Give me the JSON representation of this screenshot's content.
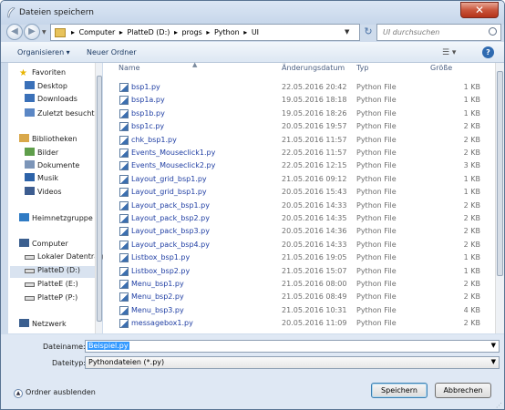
{
  "window": {
    "title": "Dateien speichern",
    "close_glyph": "✕"
  },
  "address": {
    "crumbs": [
      "Computer",
      "PlatteD (D:)",
      "progs",
      "Python",
      "UI"
    ],
    "separator": "▸",
    "search_placeholder": "UI durchsuchen"
  },
  "toolbar": {
    "organize": "Organisieren ▾",
    "new_folder": "Neuer Ordner",
    "view_glyph": "☰ ▾",
    "help": "?"
  },
  "sidebar": {
    "items": [
      {
        "label": "Favoriten",
        "icon": "star-icon",
        "color": "#e8b400",
        "indent": 0
      },
      {
        "label": "Desktop",
        "icon": "desktop-icon",
        "color": "#3a70b8",
        "indent": 1
      },
      {
        "label": "Downloads",
        "icon": "downloads-icon",
        "color": "#3a70b8",
        "indent": 1
      },
      {
        "label": "Zuletzt besucht",
        "icon": "recent-icon",
        "color": "#5b87c5",
        "indent": 1
      },
      {
        "label": "Bibliotheken",
        "icon": "libraries-icon",
        "color": "#d9a84a",
        "indent": 0
      },
      {
        "label": "Bilder",
        "icon": "pictures-icon",
        "color": "#5f9e4b",
        "indent": 1
      },
      {
        "label": "Dokumente",
        "icon": "documents-icon",
        "color": "#7c95b8",
        "indent": 1
      },
      {
        "label": "Musik",
        "icon": "music-icon",
        "color": "#2c62a8",
        "indent": 1
      },
      {
        "label": "Videos",
        "icon": "videos-icon",
        "color": "#3d5d90",
        "indent": 1
      },
      {
        "label": "Heimnetzgruppe",
        "icon": "homegroup-icon",
        "color": "#2f7bc4",
        "indent": 0
      },
      {
        "label": "Computer",
        "icon": "computer-icon",
        "color": "#3b5f8f",
        "indent": 0
      },
      {
        "label": "Lokaler Datenträg",
        "icon": "drive-icon",
        "color": "#8a8a8a",
        "indent": 1
      },
      {
        "label": "PlatteD (D:)",
        "icon": "drive-icon",
        "color": "#8a8a8a",
        "indent": 1
      },
      {
        "label": "PlatteE (E:)",
        "icon": "drive-icon",
        "color": "#8a8a8a",
        "indent": 1
      },
      {
        "label": "PlatteP (P:)",
        "icon": "drive-icon",
        "color": "#8a8a8a",
        "indent": 1
      },
      {
        "label": "Netzwerk",
        "icon": "network-icon",
        "color": "#3b5f8f",
        "indent": 0
      }
    ]
  },
  "columns": {
    "name": "Name",
    "date": "Änderungsdatum",
    "type": "Typ",
    "size": "Größe"
  },
  "files": [
    {
      "name": "bsp1.py",
      "date": "22.05.2016 20:42",
      "type": "Python File",
      "size": "1 KB"
    },
    {
      "name": "bsp1a.py",
      "date": "19.05.2016 18:18",
      "type": "Python File",
      "size": "1 KB"
    },
    {
      "name": "bsp1b.py",
      "date": "19.05.2016 18:26",
      "type": "Python File",
      "size": "1 KB"
    },
    {
      "name": "bsp1c.py",
      "date": "20.05.2016 19:57",
      "type": "Python File",
      "size": "2 KB"
    },
    {
      "name": "chk_bsp1.py",
      "date": "21.05.2016 11:57",
      "type": "Python File",
      "size": "2 KB"
    },
    {
      "name": "Events_Mouseclick1.py",
      "date": "22.05.2016 11:57",
      "type": "Python File",
      "size": "2 KB"
    },
    {
      "name": "Events_Mouseclick2.py",
      "date": "22.05.2016 12:15",
      "type": "Python File",
      "size": "3 KB"
    },
    {
      "name": "Layout_grid_bsp1.py",
      "date": "21.05.2016 09:12",
      "type": "Python File",
      "size": "1 KB"
    },
    {
      "name": "Layout_grid_bsp1.py",
      "date": "20.05.2016 15:43",
      "type": "Python File",
      "size": "1 KB"
    },
    {
      "name": "Layout_pack_bsp1.py",
      "date": "20.05.2016 14:33",
      "type": "Python File",
      "size": "2 KB"
    },
    {
      "name": "Layout_pack_bsp2.py",
      "date": "20.05.2016 14:35",
      "type": "Python File",
      "size": "2 KB"
    },
    {
      "name": "Layout_pack_bsp3.py",
      "date": "20.05.2016 14:36",
      "type": "Python File",
      "size": "2 KB"
    },
    {
      "name": "Layout_pack_bsp4.py",
      "date": "20.05.2016 14:33",
      "type": "Python File",
      "size": "2 KB"
    },
    {
      "name": "Listbox_bsp1.py",
      "date": "21.05.2016 19:05",
      "type": "Python File",
      "size": "1 KB"
    },
    {
      "name": "Listbox_bsp2.py",
      "date": "21.05.2016 15:07",
      "type": "Python File",
      "size": "1 KB"
    },
    {
      "name": "Menu_bsp1.py",
      "date": "21.05.2016 08:00",
      "type": "Python File",
      "size": "2 KB"
    },
    {
      "name": "Menu_bsp2.py",
      "date": "21.05.2016 08:49",
      "type": "Python File",
      "size": "2 KB"
    },
    {
      "name": "Menu_bsp3.py",
      "date": "21.05.2016 10:31",
      "type": "Python File",
      "size": "4 KB"
    },
    {
      "name": "messagebox1.py",
      "date": "20.05.2016 11:09",
      "type": "Python File",
      "size": "2 KB"
    }
  ],
  "form": {
    "filename_label": "Dateiname:",
    "filename_value": "Beispiel.py",
    "filetype_label": "Dateityp:",
    "filetype_value": "Pythondateien (*.py)",
    "hide_folders": "Ordner ausblenden",
    "save": "Speichern",
    "cancel": "Abbrechen"
  }
}
